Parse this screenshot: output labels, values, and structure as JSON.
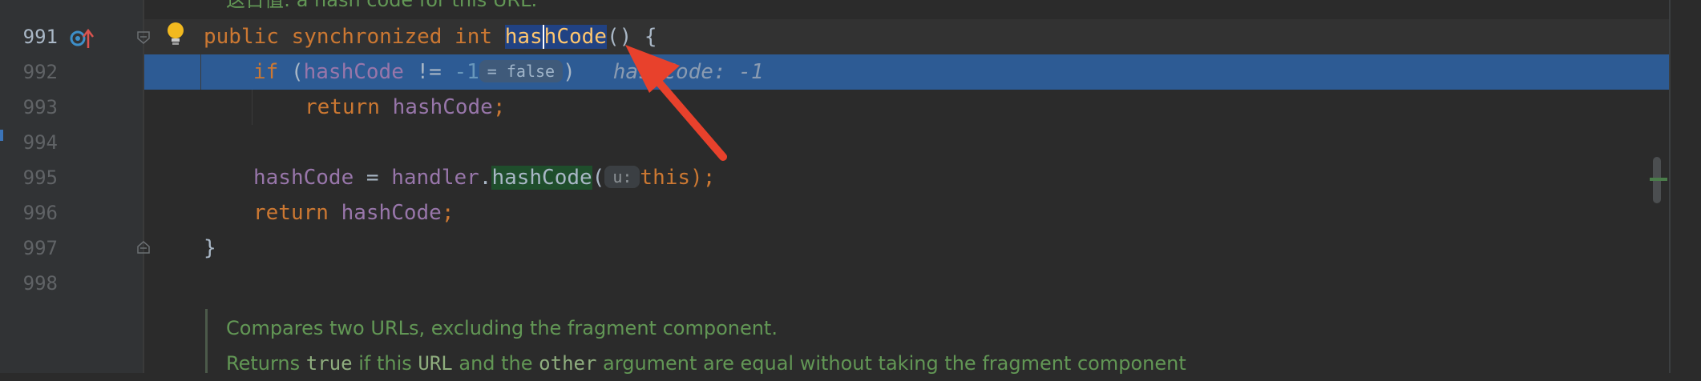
{
  "editor": {
    "top_doc_fragment": "这日值: a hash code for this URL.",
    "current_line": 991,
    "lines": [
      {
        "num": "991"
      },
      {
        "num": "992"
      },
      {
        "num": "993"
      },
      {
        "num": "994"
      },
      {
        "num": "995"
      },
      {
        "num": "996"
      },
      {
        "num": "997"
      },
      {
        "num": "998"
      }
    ],
    "code": {
      "l991": {
        "kw1": "public",
        "kw2": "synchronized",
        "kw3": "int",
        "fn_a": "has",
        "fn_b": "hCode",
        "tail": "() {"
      },
      "l992": {
        "kw": "if",
        "open": " (",
        "field": "hashCode",
        "op": " != ",
        "num": "-1",
        "hint": "= false",
        "close": ")",
        "inline_value": "hashCode: -1"
      },
      "l993": {
        "kw": "return",
        "field": "hashCode",
        "semi": ";"
      },
      "l995": {
        "field": "hashCode",
        "assign": " = ",
        "obj": "handler",
        "dot": ".",
        "call": "hashCode",
        "open": "(",
        "param_hint": "u:",
        "this": "this",
        "close": ");"
      },
      "l996": {
        "kw": "return",
        "field": "hashCode",
        "semi": ";"
      },
      "l997": {
        "brace": "}"
      }
    },
    "doc": {
      "line1": "Compares two URLs, excluding the fragment component.",
      "line2_a": "Returns ",
      "line2_true": "true",
      "line2_b": " if this ",
      "line2_url": "URL",
      "line2_c": " and the ",
      "line2_other": "other",
      "line2_d": " argument are equal without taking the fragment component"
    }
  },
  "colors": {
    "background": "#2b2b2b",
    "selection": "#2d5b94",
    "keyword": "#cc7832",
    "field": "#9876aa",
    "number": "#6897bb",
    "doc_comment": "#629755",
    "arrow": "#e8412c",
    "lightbulb": "#f2b91f"
  },
  "icons": [
    "implementation-gutter-icon",
    "override-arrow-icon",
    "lightbulb-icon",
    "fold-icon",
    "annotation-arrow-icon"
  ]
}
